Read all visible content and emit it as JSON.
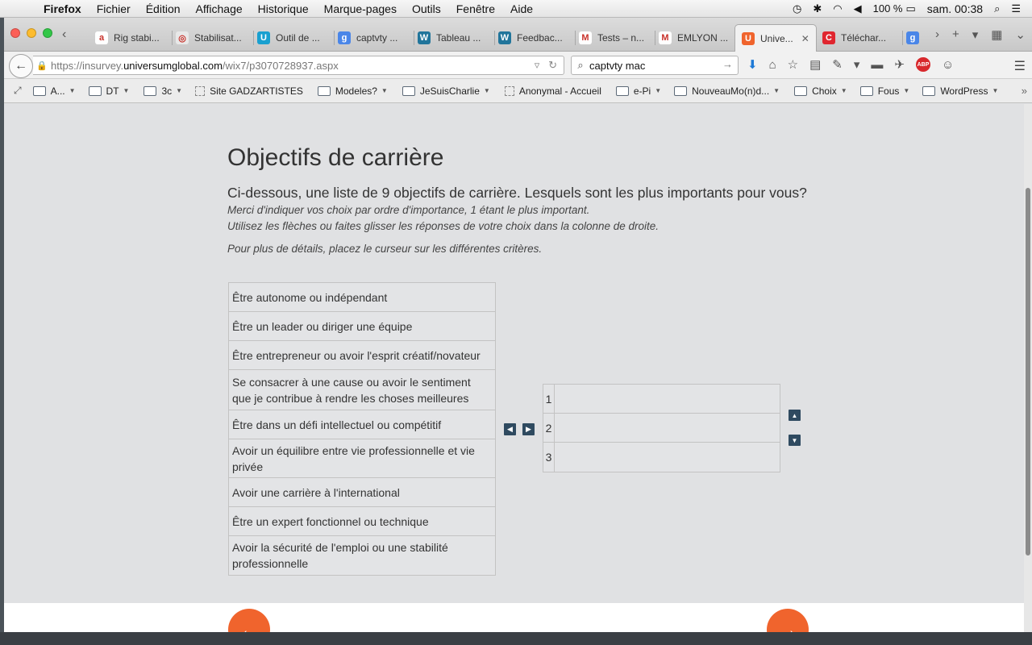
{
  "menubar": {
    "app": "Firefox",
    "items": [
      "Fichier",
      "Édition",
      "Affichage",
      "Historique",
      "Marque-pages",
      "Outils",
      "Fenêtre",
      "Aide"
    ],
    "battery": "100 %",
    "clock": "sam. 00:38"
  },
  "tabs": [
    {
      "label": "Rig stabi...",
      "icon": "amazon-icon",
      "color": "#ffffff",
      "glyph": "a"
    },
    {
      "label": "Stabilisat...",
      "icon": "site-icon",
      "color": "#e8e8e8",
      "glyph": "◎"
    },
    {
      "label": "Outil de ...",
      "icon": "tool-icon",
      "color": "#19a0d0",
      "glyph": "U"
    },
    {
      "label": "captvty ...",
      "icon": "google-icon",
      "color": "#4a86e8",
      "glyph": "g"
    },
    {
      "label": "Tableau ...",
      "icon": "wordpress-icon",
      "color": "#21759b",
      "glyph": "W"
    },
    {
      "label": "Feedbac...",
      "icon": "wordpress-icon",
      "color": "#21759b",
      "glyph": "W"
    },
    {
      "label": "Tests – n...",
      "icon": "gmail-icon",
      "color": "#ffffff",
      "glyph": "M"
    },
    {
      "label": "EMLYON ...",
      "icon": "gmail-icon",
      "color": "#ffffff",
      "glyph": "M"
    },
    {
      "label": "Unive...",
      "icon": "universum-icon",
      "color": "#f0642d",
      "glyph": "U"
    },
    {
      "label": "Téléchar...",
      "icon": "download-icon",
      "color": "#e0262f",
      "glyph": "C"
    },
    {
      "label": "",
      "icon": "google-icon",
      "color": "#4a86e8",
      "glyph": "g"
    }
  ],
  "url": {
    "prefix": "https://insurvey.",
    "host": "universumglobal.com",
    "path": "/wix7/p3070728937.aspx"
  },
  "search": {
    "value": "captvty mac"
  },
  "bookmarks": [
    {
      "label": "A...",
      "type": "folder",
      "dropdown": true
    },
    {
      "label": "DT",
      "type": "folder",
      "dropdown": true
    },
    {
      "label": "3c",
      "type": "folder",
      "dropdown": true
    },
    {
      "label": "Site GADZARTISTES",
      "type": "page",
      "dropdown": false
    },
    {
      "label": "Modeles?",
      "type": "folder",
      "dropdown": true
    },
    {
      "label": "JeSuisCharlie",
      "type": "folder",
      "dropdown": true
    },
    {
      "label": "Anonymal - Accueil",
      "type": "page",
      "dropdown": false
    },
    {
      "label": "e-Pi",
      "type": "folder",
      "dropdown": true
    },
    {
      "label": "NouveauMo(n)d...",
      "type": "folder",
      "dropdown": true
    },
    {
      "label": "Choix",
      "type": "folder",
      "dropdown": true
    },
    {
      "label": "Fous",
      "type": "folder",
      "dropdown": true
    },
    {
      "label": "WordPress",
      "type": "folder",
      "dropdown": true
    }
  ],
  "survey": {
    "title": "Objectifs de carrière",
    "question": "Ci-dessous, une liste de 9 objectifs de carrière. Lesquels sont les plus importants pour vous?",
    "instruction_1": "Merci d'indiquer vos choix par ordre d'importance, 1 étant le plus important.",
    "instruction_2": "Utilisez les flèches ou faites glisser les réponses de votre choix dans la colonne de droite.",
    "instruction_3": "Pour plus de détails, placez le curseur sur les différentes critères.",
    "options": [
      "Être autonome ou indépendant",
      "Être un leader ou diriger une équipe",
      "Être entrepreneur ou avoir l'esprit créatif/novateur",
      "Se consacrer à une cause ou avoir le sentiment que je contribue à rendre les choses meilleures",
      "Être dans un défi intellectuel ou compétitif",
      "Avoir un équilibre entre vie professionnelle et vie privée",
      "Avoir une carrière à l'international",
      "Être un expert fonctionnel ou technique",
      "Avoir la sécurité de l'emploi ou une stabilité professionnelle"
    ],
    "ranks": [
      "1",
      "2",
      "3"
    ]
  },
  "colors": {
    "accent": "#f0642d",
    "control": "#2f4a60",
    "page_bg": "#e0e1e3"
  }
}
